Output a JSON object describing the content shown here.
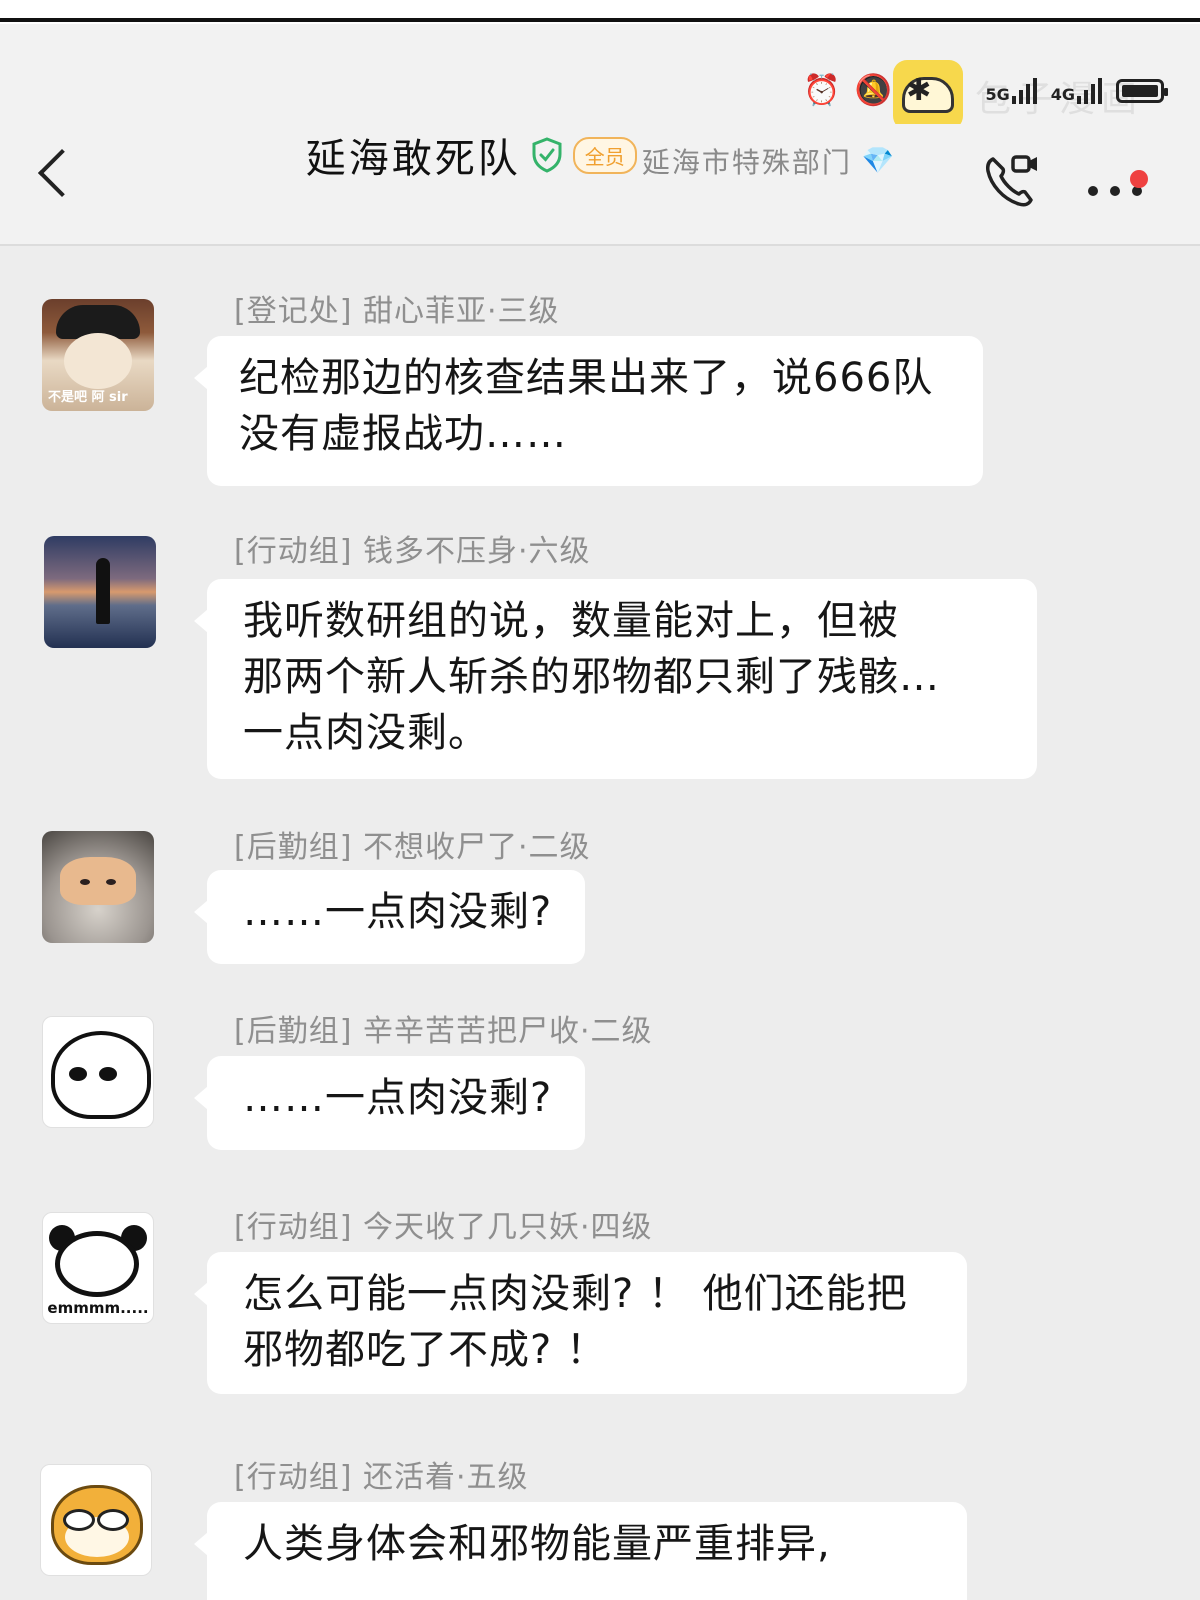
{
  "status_bar": {
    "network_1": "5G",
    "network_2": "4G",
    "icons": [
      "alarm-icon",
      "mute-bell-icon",
      "bluetooth-icon",
      "wifi-icon",
      "app-logo-icon",
      "battery-icon"
    ],
    "watermark": "包子漫画"
  },
  "header": {
    "title": "延海敢死队",
    "member_badge": "全员",
    "subtitle": "延海市特殊部门",
    "colors": {
      "verified": "#34b36a",
      "member_badge": "#f0a030",
      "diamond": "#35b8e8",
      "notification_dot": "#ef4140"
    }
  },
  "messages": [
    {
      "sender": "[登记处] 甜心菲亚·三级",
      "lines": [
        "纪检那边的核查结果出来了，说666队",
        "没有虚报战功……"
      ],
      "avatar_caption": "不是吧 阿 sir"
    },
    {
      "sender": "[行动组] 钱多不压身·六级",
      "lines": [
        "我听数研组的说，数量能对上，但被",
        "那两个新人斩杀的邪物都只剩了残骸…",
        "一点肉没剩。"
      ]
    },
    {
      "sender": "[后勤组] 不想收尸了·二级",
      "lines": [
        "……一点肉没剩?"
      ]
    },
    {
      "sender": "[后勤组] 辛辛苦苦把尸收·二级",
      "lines": [
        "……一点肉没剩?"
      ]
    },
    {
      "sender": "[行动组] 今天收了几只妖·四级",
      "lines": [
        "怎么可能一点肉没剩? ！ 他们还能把",
        "邪物都吃了不成? ！"
      ],
      "avatar_caption": "emmmm....."
    },
    {
      "sender": "[行动组] 还活着·五级",
      "lines": [
        "人类身体会和邪物能量严重排异,"
      ]
    }
  ]
}
